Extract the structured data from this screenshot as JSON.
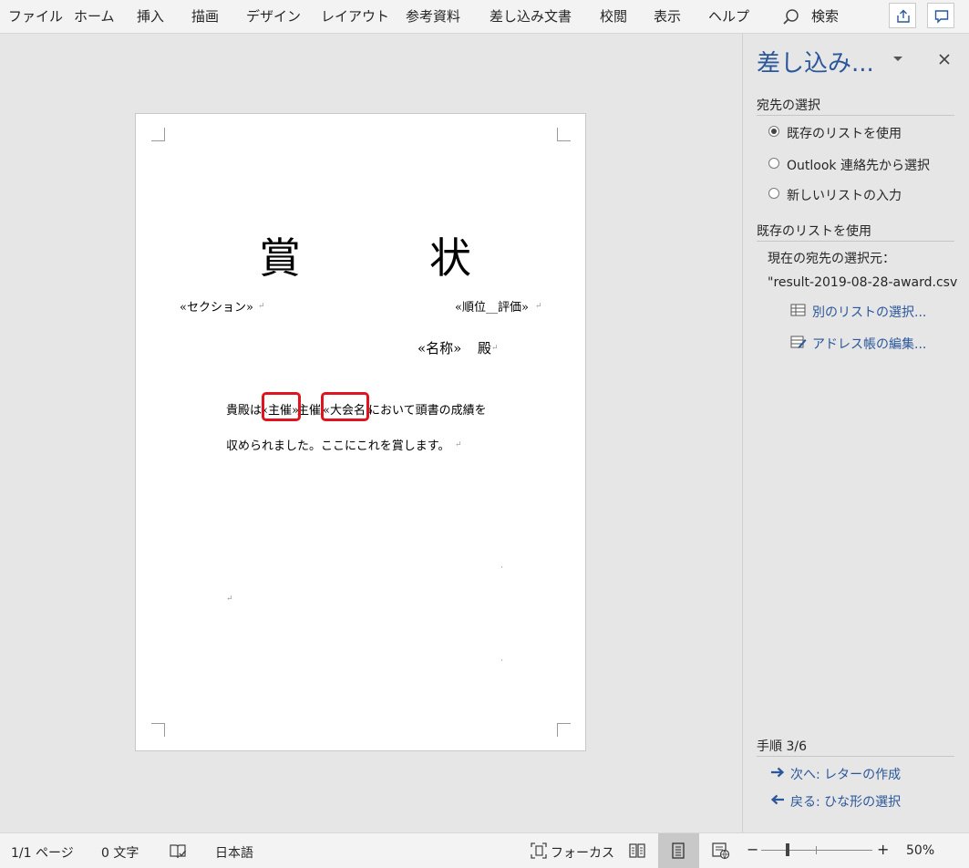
{
  "ribbon": {
    "tabs": [
      "ファイル",
      "ホーム",
      "挿入",
      "描画",
      "デザイン",
      "レイアウト",
      "参考資料",
      "差し込み文書",
      "校閲",
      "表示",
      "ヘルプ"
    ],
    "search_label": "検索"
  },
  "document": {
    "title_left": "賞",
    "title_right": "状",
    "field_section": "«セクション»",
    "field_rank": "«順位__評価»",
    "field_name": "«名称»",
    "honorific": "殿",
    "body_line1_a": "貴殿は",
    "body_field_organizer": "«主催»",
    "body_line1_b": "主催",
    "body_field_event": "«大会名»",
    "body_line1_c": "において頭書の成績を",
    "body_line2": "収められました。ここにこれを賞します。"
  },
  "pane": {
    "title": "差し込み...",
    "section_recipients": "宛先の選択",
    "options": [
      {
        "label": "既存のリストを使用",
        "selected": true
      },
      {
        "label": "Outlook 連絡先から選択",
        "selected": false
      },
      {
        "label": "新しいリストの入力",
        "selected": false
      }
    ],
    "section_existing": "既存のリストを使用",
    "current_source_label": "現在の宛先の選択元：",
    "current_source_value": "\"result-2019-08-28-award.csv",
    "link_select_other": "別のリストの選択...",
    "link_edit_addressbook": "アドレス帳の編集...",
    "step_label": "手順 3/6",
    "next_link": "次へ: レターの作成",
    "back_link": "戻る: ひな形の選択"
  },
  "status": {
    "page": "1/1 ページ",
    "words": "0 文字",
    "language": "日本語",
    "focus": "フォーカス",
    "zoom": "50%"
  },
  "colors": {
    "accent": "#2b579a",
    "highlight": "#e0141e"
  }
}
